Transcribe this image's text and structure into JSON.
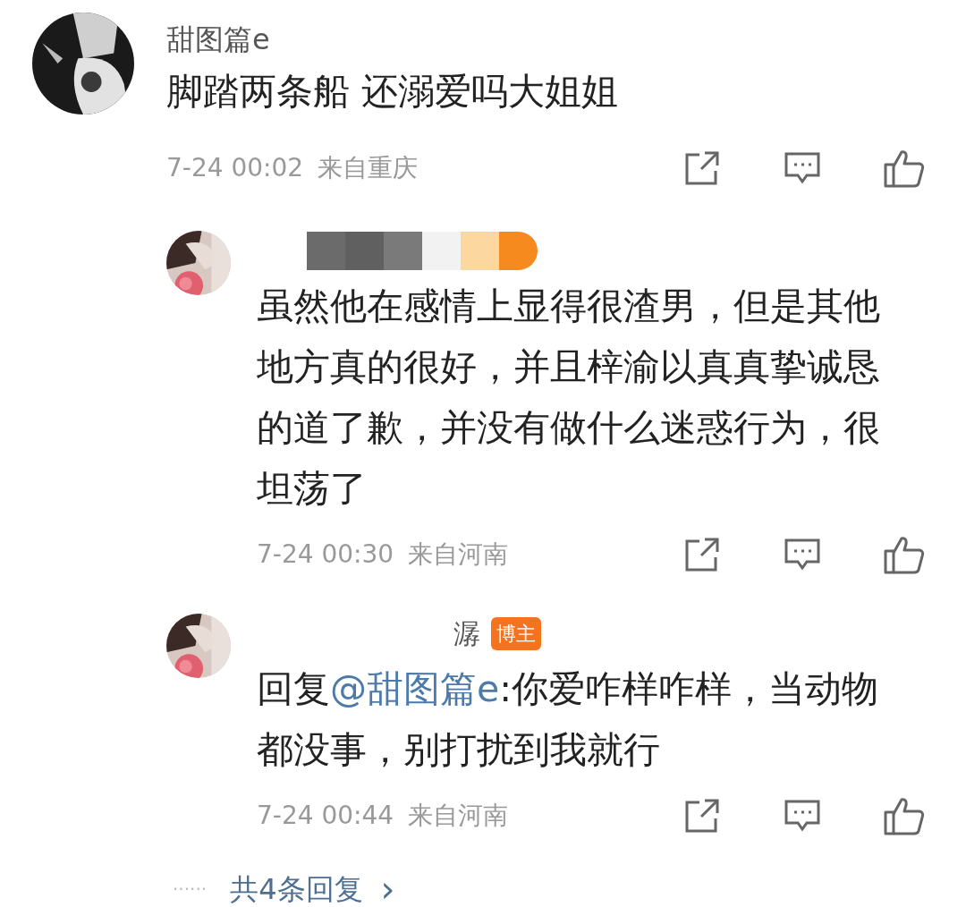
{
  "comment": {
    "author": "甜图篇e",
    "text": "脚踏两条船 还溺爱吗大姐姐",
    "time": "7-24 00:02",
    "location": "来自重庆"
  },
  "replies": [
    {
      "redacted": true,
      "text_parts": [
        {
          "kind": "plain",
          "text": "虽然他在感情上显得很渣男，但是其他地方真的很好，并且梓渝以真真挚诚恳的道了歉，并没有做什么迷惑行为，很坦荡了"
        }
      ],
      "time": "7-24 00:30",
      "location": "来自河南"
    },
    {
      "author": "潺",
      "redacted": false,
      "badge": "博主",
      "text_parts": [
        {
          "kind": "plain",
          "text": "回复"
        },
        {
          "kind": "mention",
          "text": "@甜图篇e"
        },
        {
          "kind": "plain",
          "text": ":你爱咋样咋样，当动物都没事，别打扰到我就行"
        }
      ],
      "time": "7-24 00:44",
      "location": "来自河南"
    }
  ],
  "more_replies": {
    "dots": "······",
    "label": "共4条回复",
    "chevron": "›"
  }
}
